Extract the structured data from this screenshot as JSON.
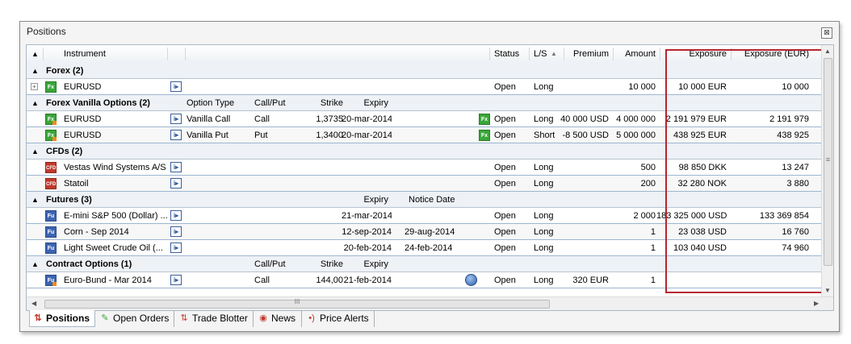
{
  "window": {
    "title": "Positions",
    "close_label": "⊠"
  },
  "header": {
    "instrument": "Instrument",
    "status": "Status",
    "ls": "L/S",
    "ls_sort": "▲",
    "premium": "Premium",
    "amount": "Amount",
    "exposure": "Exposure",
    "exposure_eur": "Exposure (EUR)"
  },
  "groups": {
    "forex": {
      "title": "Forex (2)"
    },
    "fxo": {
      "title": "Forex Vanilla Options (2)",
      "c1": "Option Type",
      "c2": "Call/Put",
      "c3": "Strike",
      "c4": "Expiry"
    },
    "cfd": {
      "title": "CFDs (2)"
    },
    "fut": {
      "title": "Futures (3)",
      "c1": "Expiry",
      "c2": "Notice Date"
    },
    "co": {
      "title": "Contract Options (1)",
      "c1": "Call/Put",
      "c2": "Strike",
      "c3": "Expiry"
    }
  },
  "rows": {
    "forex1": {
      "icon": "Fx",
      "name": "EURUSD",
      "status": "Open",
      "ls": "Long",
      "premium": "",
      "amount": "10 000",
      "exposure": "10 000 EUR",
      "exposure_eur": "10 000"
    },
    "fxo1": {
      "icon": "Fx",
      "name": "EURUSD",
      "opt": "Vanilla Call",
      "cp": "Call",
      "strike": "1,3735",
      "expiry": "20-mar-2014",
      "status_icon": "Fx",
      "status": "Open",
      "ls": "Long",
      "premium": "40 000 USD",
      "amount": "4 000 000",
      "exposure": "2 191 979 EUR",
      "exposure_eur": "2 191 979"
    },
    "fxo2": {
      "icon": "Fx",
      "name": "EURUSD",
      "opt": "Vanilla Put",
      "cp": "Put",
      "strike": "1,3400",
      "expiry": "20-mar-2014",
      "status_icon": "Fx",
      "status": "Open",
      "ls": "Short",
      "premium": "-8 500 USD",
      "amount": "5 000 000",
      "exposure": "438 925 EUR",
      "exposure_eur": "438 925"
    },
    "cfd1": {
      "icon": "CFD",
      "name": "Vestas Wind Systems A/S",
      "status": "Open",
      "ls": "Long",
      "amount": "500",
      "exposure": "98 850 DKK",
      "exposure_eur": "13 247"
    },
    "cfd2": {
      "icon": "CFD",
      "name": "Statoil",
      "status": "Open",
      "ls": "Long",
      "amount": "200",
      "exposure": "32 280 NOK",
      "exposure_eur": "3 880"
    },
    "fut1": {
      "icon": "Fu",
      "name": "E-mini S&P 500 (Dollar) ...",
      "expiry": "21-mar-2014",
      "notice": "",
      "status": "Open",
      "ls": "Long",
      "amount": "2 000",
      "exposure": "183 325 000 USD",
      "exposure_eur": "133 369 854"
    },
    "fut2": {
      "icon": "Fu",
      "name": "Corn - Sep 2014",
      "expiry": "12-sep-2014",
      "notice": "29-aug-2014",
      "status": "Open",
      "ls": "Long",
      "amount": "1",
      "exposure": "23 038 USD",
      "exposure_eur": "16 760"
    },
    "fut3": {
      "icon": "Fu",
      "name": "Light Sweet Crude Oil (...",
      "expiry": "20-feb-2014",
      "notice": "24-feb-2014",
      "status": "Open",
      "ls": "Long",
      "amount": "1",
      "exposure": "103 040 USD",
      "exposure_eur": "74 960"
    },
    "co1": {
      "icon": "Fu",
      "name": "Euro-Bund - Mar 2014",
      "cp": "Call",
      "strike": "144,00",
      "expiry": "21-feb-2014",
      "status": "Open",
      "ls": "Long",
      "premium": "320 EUR",
      "amount": "1"
    }
  },
  "info_icon": "i▸",
  "scroll": {
    "grip": "≡",
    "h_grip": "III"
  },
  "tabs": {
    "positions": "Positions",
    "open_orders": "Open Orders",
    "trade_blotter": "Trade Blotter",
    "news": "News",
    "price_alerts": "Price Alerts"
  },
  "colors": {
    "highlight": "#b5262f",
    "fx": "#3aa63a",
    "cfd": "#c0392b",
    "fu": "#3b64b3"
  }
}
